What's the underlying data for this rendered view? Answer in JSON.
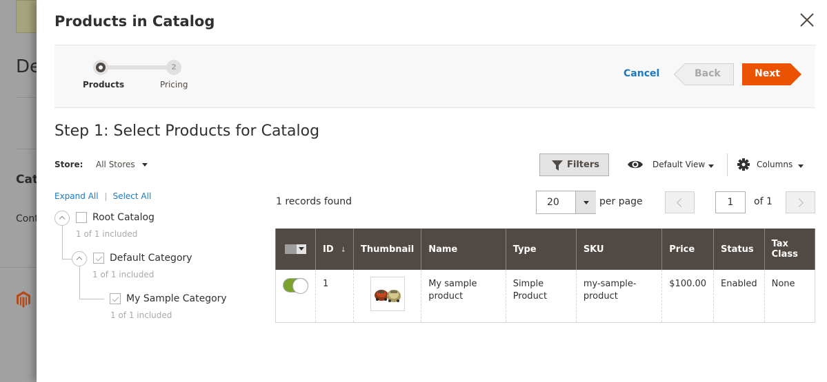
{
  "background": {
    "heading_fragment": "De",
    "section_fragment": "Cata",
    "content_fragment": "Cont",
    "logo_icon": "magento-logo-icon"
  },
  "modal": {
    "title": "Products in Catalog",
    "close_icon": "close-icon"
  },
  "wizard": {
    "steps": [
      {
        "label": "Products",
        "number": "1",
        "active": true
      },
      {
        "label": "Pricing",
        "number": "2",
        "active": false
      }
    ],
    "cancel_label": "Cancel",
    "back_label": "Back",
    "next_label": "Next",
    "accent_color": "#eb5202"
  },
  "step_title": "Step 1: Select Products for Catalog",
  "store": {
    "label": "Store:",
    "selected": "All Stores"
  },
  "tree": {
    "expand_all": "Expand All",
    "select_all": "Select All",
    "nodes": [
      {
        "name": "Root Catalog",
        "included": "1 of 1 included",
        "checked": false
      },
      {
        "name": "Default Category",
        "included": "1 of 1 included",
        "checked": true
      },
      {
        "name": "My Sample Category",
        "included": "1 of 1 included",
        "checked": true
      }
    ]
  },
  "toolbar": {
    "filters_label": "Filters",
    "view_label": "Default View",
    "columns_label": "Columns",
    "records_found": "1 records found",
    "per_page_value": "20",
    "per_page_label": "per page",
    "current_page": "1",
    "page_of": "of 1"
  },
  "grid": {
    "columns": [
      "",
      "ID",
      "Thumbnail",
      "Name",
      "Type",
      "SKU",
      "Price",
      "Status",
      "Tax Class"
    ],
    "sort_indicator": "↓",
    "rows": [
      {
        "selected": true,
        "id": "1",
        "name": "My sample product",
        "type": "Simple Product",
        "sku": "my-sample-product",
        "price": "$100.00",
        "status": "Enabled",
        "tax_class": "None"
      }
    ],
    "header_color": "#514943",
    "toggle_on_color": "#79a22e"
  }
}
